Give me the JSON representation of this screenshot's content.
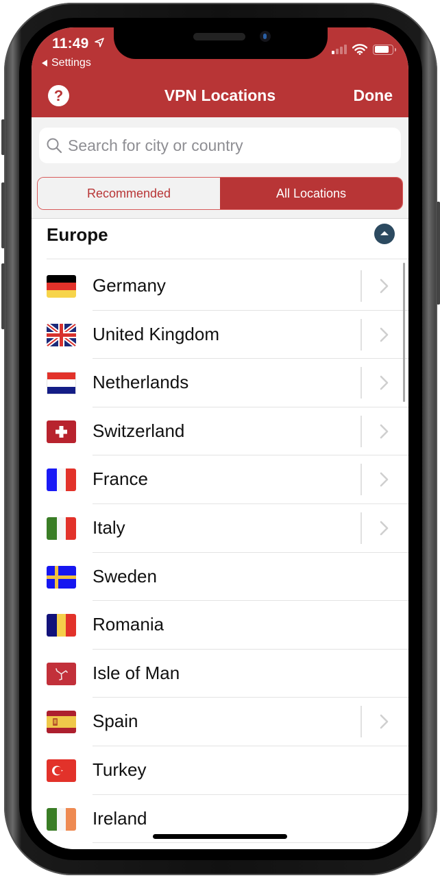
{
  "status_bar": {
    "time": "11:49",
    "back_app": "Settings",
    "signal_bars_active": 1,
    "signal_bars_total": 4,
    "battery_level": 0.8
  },
  "nav": {
    "title": "VPN Locations",
    "help_label": "?",
    "done_label": "Done"
  },
  "search": {
    "placeholder": "Search for city or country",
    "value": ""
  },
  "segment": {
    "options": [
      {
        "label": "Recommended",
        "selected": false
      },
      {
        "label": "All Locations",
        "selected": true
      }
    ]
  },
  "section": {
    "title": "Europe",
    "expanded": true
  },
  "locations": [
    {
      "name": "Germany",
      "flag": "germany-flag",
      "has_detail": true
    },
    {
      "name": "United Kingdom",
      "flag": "uk-flag",
      "has_detail": true
    },
    {
      "name": "Netherlands",
      "flag": "netherlands-flag",
      "has_detail": true
    },
    {
      "name": "Switzerland",
      "flag": "switzerland-flag",
      "has_detail": true
    },
    {
      "name": "France",
      "flag": "france-flag",
      "has_detail": true
    },
    {
      "name": "Italy",
      "flag": "italy-flag",
      "has_detail": true
    },
    {
      "name": "Sweden",
      "flag": "sweden-flag",
      "has_detail": false
    },
    {
      "name": "Romania",
      "flag": "romania-flag",
      "has_detail": false
    },
    {
      "name": "Isle of Man",
      "flag": "isle-of-man-flag",
      "has_detail": false
    },
    {
      "name": "Spain",
      "flag": "spain-flag",
      "has_detail": true
    },
    {
      "name": "Turkey",
      "flag": "turkey-flag",
      "has_detail": false
    },
    {
      "name": "Ireland",
      "flag": "ireland-flag",
      "has_detail": false
    }
  ],
  "colors": {
    "brand_red": "#b83536",
    "section_button": "#2c4a60"
  }
}
